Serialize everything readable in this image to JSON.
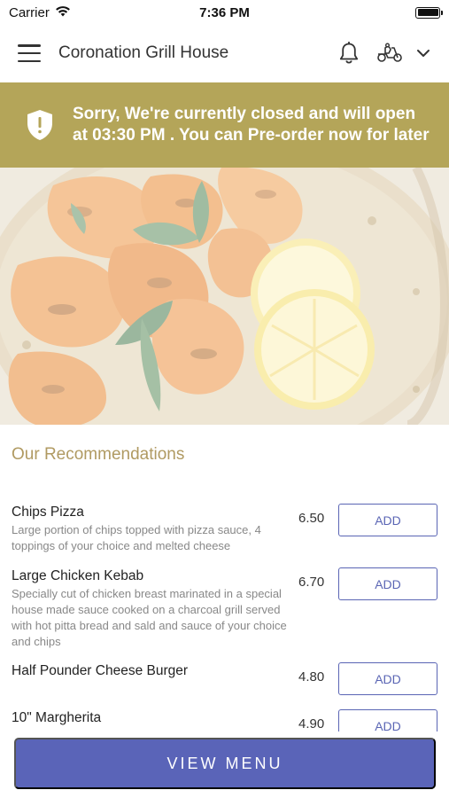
{
  "status_bar": {
    "carrier": "Carrier",
    "time": "7:36 PM",
    "battery_level": 1.0
  },
  "header": {
    "title": "Coronation Grill House",
    "icons": [
      "menu-icon",
      "bell-icon",
      "scooter-icon",
      "chevron-down-icon"
    ]
  },
  "closed_banner": {
    "message": "Sorry, We're currently closed and will open at 03:30 PM . You can Pre-order now for later",
    "icon": "shield-alert-icon",
    "color": "#b4a559"
  },
  "recommendations": {
    "title": "Our Recommendations",
    "items": [
      {
        "name": "Chips Pizza",
        "description": "Large portion of chips topped with pizza sauce, 4 toppings of your choice and melted cheese",
        "price": "6.50",
        "button": "ADD"
      },
      {
        "name": "Large Chicken Kebab",
        "description": "Specially cut of chicken breast marinated in a special house made sauce cooked on a charcoal grill served with hot pitta bread and sald and sauce of your choice and chips",
        "price": "6.70",
        "button": "ADD"
      },
      {
        "name": "Half Pounder Cheese Burger",
        "description": "",
        "price": "4.80",
        "button": "ADD"
      },
      {
        "name": "10\" Margherita",
        "description": "",
        "price": "4.90",
        "button": "ADD"
      }
    ]
  },
  "footer": {
    "view_menu_label": "VIEW MENU",
    "accent_color": "#5a64b8"
  }
}
